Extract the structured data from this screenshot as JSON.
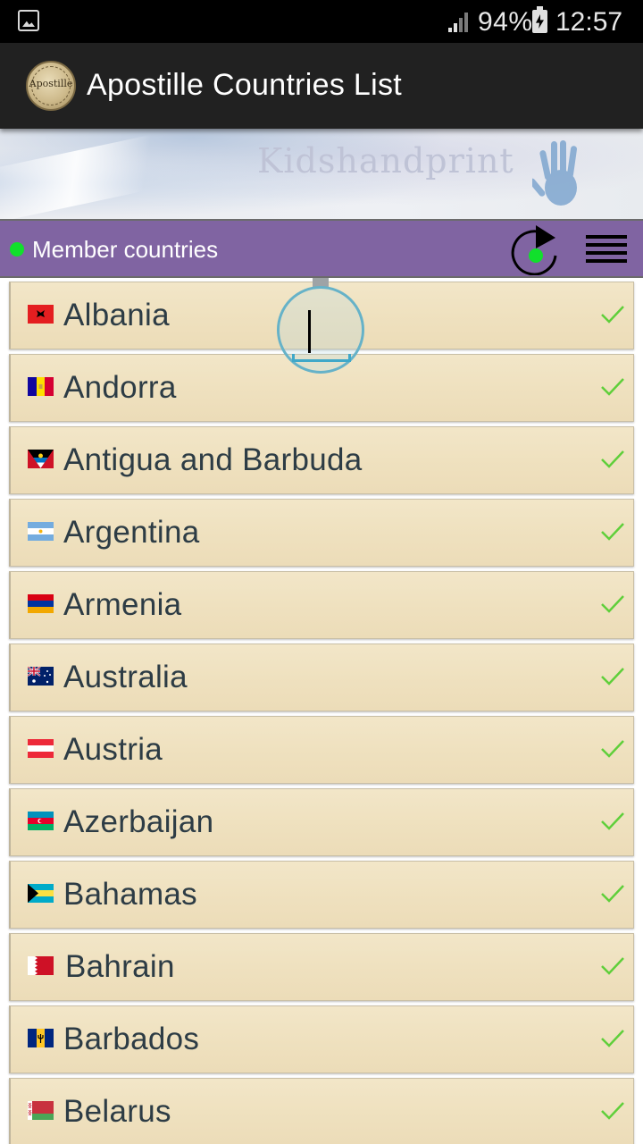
{
  "status_bar": {
    "battery_percent": "94%",
    "time": "12:57",
    "icons": [
      "gallery-icon",
      "signal-icon",
      "battery-charging-icon"
    ]
  },
  "app_bar": {
    "title": "Apostille Countries List",
    "logo_text": "Apostille",
    "logo_icon": "apostille-seal-icon"
  },
  "banner": {
    "brand": "Kidshandprint",
    "icon": "handprint-icon"
  },
  "section": {
    "title": "Member countries",
    "status_color": "#11e02c",
    "header_color": "#8064a2",
    "refresh_icon": "refresh-icon",
    "menu_icon": "hamburger-menu-icon"
  },
  "countries": [
    {
      "name": "Albania",
      "flag": "albania-flag-icon",
      "member": true
    },
    {
      "name": "Andorra",
      "flag": "andorra-flag-icon",
      "member": true
    },
    {
      "name": "Antigua and Barbuda",
      "flag": "antigua-and-barbuda-flag-icon",
      "member": true
    },
    {
      "name": "Argentina",
      "flag": "argentina-flag-icon",
      "member": true
    },
    {
      "name": "Armenia",
      "flag": "armenia-flag-icon",
      "member": true
    },
    {
      "name": "Australia",
      "flag": "australia-flag-icon",
      "member": true
    },
    {
      "name": "Austria",
      "flag": "austria-flag-icon",
      "member": true
    },
    {
      "name": "Azerbaijan",
      "flag": "azerbaijan-flag-icon",
      "member": true
    },
    {
      "name": "Bahamas",
      "flag": "bahamas-flag-icon",
      "member": true
    },
    {
      "name": "Bahrain",
      "flag": "bahrain-flag-icon",
      "member": true
    },
    {
      "name": "Barbados",
      "flag": "barbados-flag-icon",
      "member": true
    },
    {
      "name": "Belarus",
      "flag": "belarus-flag-icon",
      "member": true
    }
  ],
  "check_color": "#5fcf3a"
}
